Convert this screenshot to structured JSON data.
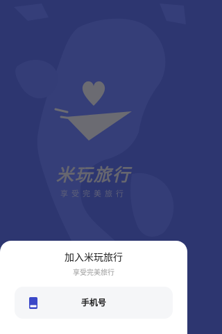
{
  "splash": {
    "brand_name": "米玩旅行",
    "slogan": "享受完美旅行",
    "logo_icon": "heart-plane-icon",
    "background_color": "#2d3670"
  },
  "login_sheet": {
    "title": "加入米玩旅行",
    "subtitle": "享受完美旅行",
    "options": [
      {
        "label": "手机号",
        "icon": "phone-icon",
        "icon_color": "#3b48c8"
      }
    ]
  }
}
